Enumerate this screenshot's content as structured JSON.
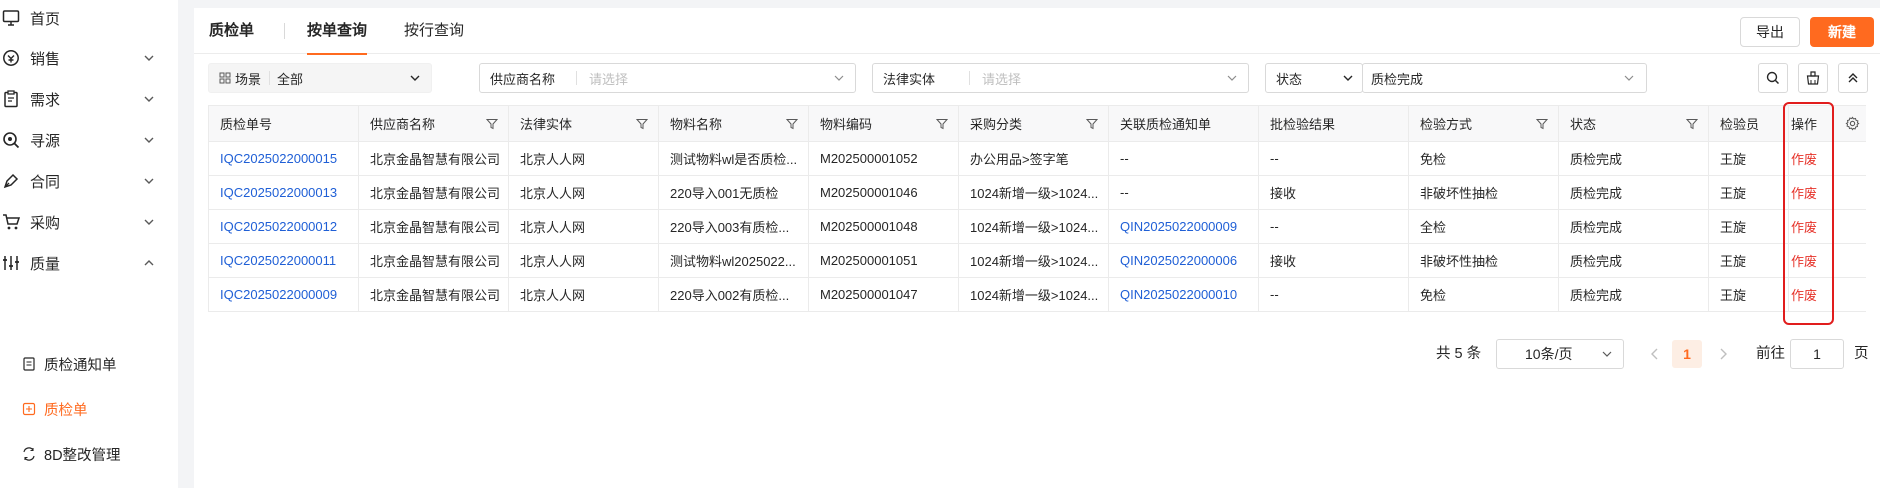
{
  "sidebar": {
    "items": [
      {
        "label": "首页",
        "icon": "monitor-icon"
      },
      {
        "label": "销售",
        "icon": "sales-icon"
      },
      {
        "label": "需求",
        "icon": "clipboard-icon"
      },
      {
        "label": "寻源",
        "icon": "search-source-icon"
      },
      {
        "label": "合同",
        "icon": "pen-icon"
      },
      {
        "label": "采购",
        "icon": "cart-icon"
      },
      {
        "label": "质量",
        "icon": "sliders-icon"
      }
    ],
    "sub_items": [
      {
        "label": "质检通知单",
        "icon": "notice-icon"
      },
      {
        "label": "质检单",
        "icon": "inspection-icon",
        "active": true
      },
      {
        "label": "8D整改管理",
        "icon": "rectify-icon"
      }
    ]
  },
  "tabs": {
    "title": "质检单",
    "by_order": "按单查询",
    "by_line": "按行查询"
  },
  "actions": {
    "export": "导出",
    "new": "新建"
  },
  "filters": {
    "scene_label": "场景",
    "scene_value": "全部",
    "supplier_label": "供应商名称",
    "supplier_placeholder": "请选择",
    "entity_label": "法律实体",
    "entity_placeholder": "请选择",
    "status_label": "状态",
    "status_value": "质检完成"
  },
  "table": {
    "headers": [
      "质检单号",
      "供应商名称",
      "法律实体",
      "物料名称",
      "物料编码",
      "采购分类",
      "关联质检通知单",
      "批检验结果",
      "检验方式",
      "状态",
      "检验员",
      "操作"
    ],
    "rows": [
      [
        "IQC2025022000015",
        "北京金晶智慧有限公司",
        "北京人人网",
        "测试物料wl是否质检...",
        "M202500001052",
        "办公用品>签字笔",
        "--",
        "--",
        "免检",
        "质检完成",
        "王旋",
        "作废"
      ],
      [
        "IQC2025022000013",
        "北京金晶智慧有限公司",
        "北京人人网",
        "220导入001无质检",
        "M202500001046",
        "1024新增一级>1024...",
        "--",
        "接收",
        "非破坏性抽检",
        "质检完成",
        "王旋",
        "作废"
      ],
      [
        "IQC2025022000012",
        "北京金晶智慧有限公司",
        "北京人人网",
        "220导入003有质检...",
        "M202500001048",
        "1024新增一级>1024...",
        "QIN2025022000009",
        "--",
        "全检",
        "质检完成",
        "王旋",
        "作废"
      ],
      [
        "IQC2025022000011",
        "北京金晶智慧有限公司",
        "北京人人网",
        "测试物料wl2025022...",
        "M202500001051",
        "1024新增一级>1024...",
        "QIN2025022000006",
        "接收",
        "非破坏性抽检",
        "质检完成",
        "王旋",
        "作废"
      ],
      [
        "IQC2025022000009",
        "北京金晶智慧有限公司",
        "北京人人网",
        "220导入002有质检...",
        "M202500001047",
        "1024新增一级>1024...",
        "QIN2025022000010",
        "--",
        "免检",
        "质检完成",
        "王旋",
        "作废"
      ]
    ]
  },
  "pagination": {
    "total": "共 5 条",
    "page_size": "10条/页",
    "current_page": "1",
    "goto_label": "前往",
    "goto_value": "1",
    "page_suffix": "页"
  },
  "colors": {
    "accent": "#ff6a1f",
    "link": "#1f5fd6",
    "danger": "#e6332a",
    "highlight_box": "#e11d1d"
  }
}
